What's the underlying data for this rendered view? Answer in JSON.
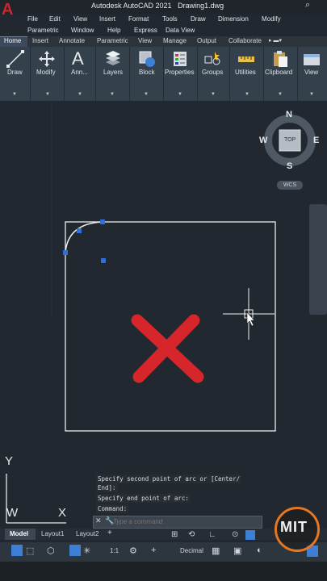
{
  "title": {
    "app": "Autodesk AutoCAD 2021",
    "file": "Drawing1.dwg"
  },
  "menu": [
    "File",
    "Edit",
    "View",
    "Insert",
    "Format",
    "Tools",
    "Draw",
    "Dimension",
    "Modify",
    "Parametric",
    "Window",
    "Help",
    "Express",
    "Data View"
  ],
  "ribbon_tabs": [
    "Home",
    "Insert",
    "Annotate",
    "Parametric",
    "View",
    "Manage",
    "Output",
    "Collaborate"
  ],
  "panels": [
    "Draw",
    "Modify",
    "Ann...",
    "Layers",
    "Block",
    "Properties",
    "Groups",
    "Utilities",
    "Clipboard",
    "View"
  ],
  "viewcube": {
    "top": "TOP",
    "n": "N",
    "s": "S",
    "e": "E",
    "w": "W",
    "wcs": "WCS"
  },
  "ucs": {
    "x": "X",
    "y": "Y"
  },
  "command": {
    "history": [
      "Specify second point of arc or [Center/",
      "End]:",
      "Specify end point of arc:",
      "Command:"
    ],
    "placeholder": "Type a command"
  },
  "layouts": [
    "Model",
    "Layout1",
    "Layout2"
  ],
  "status": {
    "units": "Decimal",
    "scale": "1:1"
  },
  "watermark": "MIT",
  "colors": {
    "accent": "#5b87b5",
    "grip": "#2f6fd6",
    "mark": "#d7262b"
  }
}
